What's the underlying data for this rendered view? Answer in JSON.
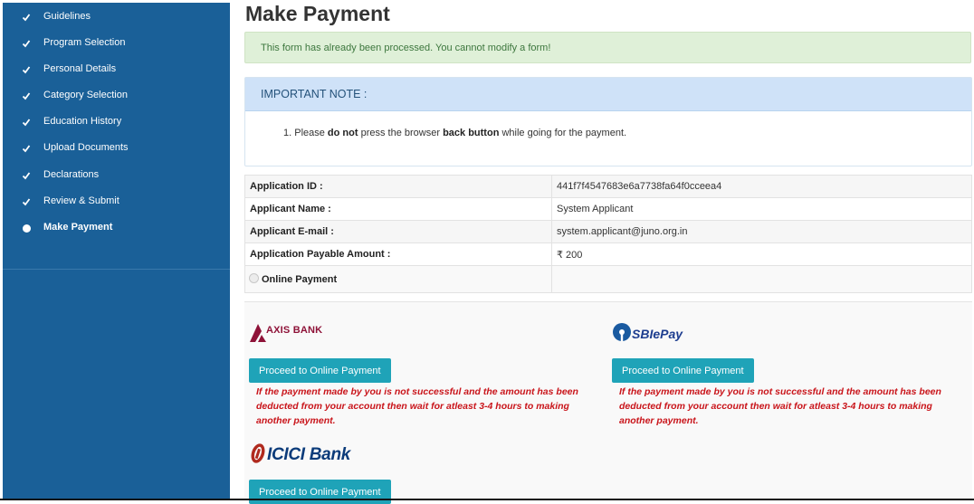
{
  "sidebar": {
    "items": [
      {
        "label": "Guidelines",
        "state": "done"
      },
      {
        "label": "Program Selection",
        "state": "done"
      },
      {
        "label": "Personal Details",
        "state": "done"
      },
      {
        "label": "Category Selection",
        "state": "done"
      },
      {
        "label": "Education History",
        "state": "done"
      },
      {
        "label": "Upload Documents",
        "state": "done"
      },
      {
        "label": "Declarations",
        "state": "done"
      },
      {
        "label": "Review & Submit",
        "state": "done"
      },
      {
        "label": "Make Payment",
        "state": "active"
      }
    ]
  },
  "page": {
    "title": "Make Payment",
    "alert": "This form has already been processed. You cannot modify a form!"
  },
  "note": {
    "heading": "IMPORTANT NOTE :",
    "item_prefix": "1. Please ",
    "item_bold1": "do not",
    "item_mid": " press the browser ",
    "item_bold2": "back button",
    "item_suffix": " while going for the payment."
  },
  "info": {
    "rows": [
      {
        "label": "Application ID :",
        "value": "441f7f4547683e6a7738fa64f0cceea4"
      },
      {
        "label": "Applicant Name :",
        "value": "System Applicant"
      },
      {
        "label": "Applicant E-mail :",
        "value": "system.applicant@juno.org.in"
      },
      {
        "label": "Application Payable Amount :",
        "value": "₹ 200"
      }
    ],
    "payment_option": "Online Payment"
  },
  "payments": {
    "axis": {
      "logo_text": "AXIS BANK",
      "button": "Proceed to Online Payment",
      "warning": "If the payment made by you is not successful and the amount has been deducted from your account then wait for atleast 3-4 hours to making another payment."
    },
    "sbi": {
      "logo_text": "SBIePay",
      "button": "Proceed to Online Payment",
      "warning": "If the payment made by you is not successful and the amount has been deducted from your account then wait for atleast 3-4 hours to making another payment."
    },
    "icici": {
      "logo_text": "ICICI Bank",
      "button": "Proceed to Online Payment"
    }
  },
  "colors": {
    "sidebar_bg": "#1a6098",
    "button_bg": "#1fa3b8",
    "warning_text": "#c9141a",
    "alert_bg": "#dff0d8",
    "note_head_bg": "#cfe2f8"
  }
}
